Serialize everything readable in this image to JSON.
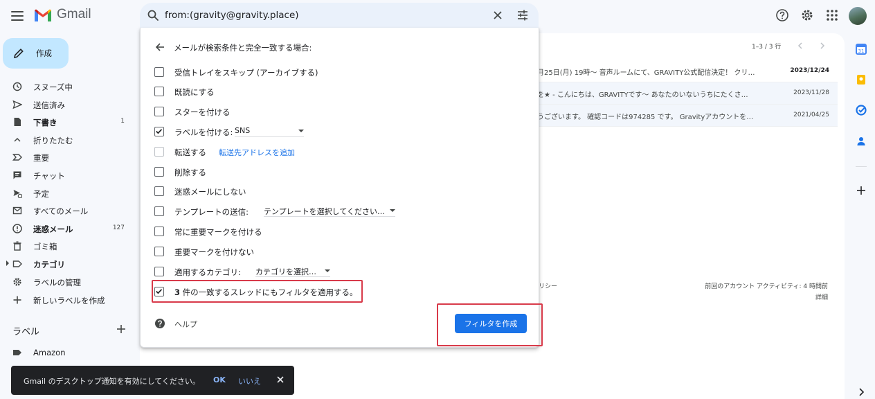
{
  "header": {
    "logo_text": "Gmail",
    "search_value": "from:(gravity@gravity.place)",
    "icons": [
      "menu-icon",
      "gmail-logo",
      "search-icon",
      "clear-icon",
      "tune-icon",
      "help-icon",
      "gear-icon",
      "apps-icon",
      "avatar"
    ]
  },
  "sidebar": {
    "compose_label": "作成",
    "items": [
      {
        "label": "スヌーズ中",
        "count": "",
        "icon": "clock-icon",
        "bold": false
      },
      {
        "label": "送信済み",
        "count": "",
        "icon": "send-icon",
        "bold": false
      },
      {
        "label": "下書き",
        "count": "1",
        "icon": "draft-icon",
        "bold": true
      },
      {
        "label": "折りたたむ",
        "count": "",
        "icon": "chevron-up-icon",
        "bold": false
      },
      {
        "label": "重要",
        "count": "",
        "icon": "important-icon",
        "bold": false
      },
      {
        "label": "チャット",
        "count": "",
        "icon": "chat-icon",
        "bold": false
      },
      {
        "label": "予定",
        "count": "",
        "icon": "scheduled-icon",
        "bold": false
      },
      {
        "label": "すべてのメール",
        "count": "",
        "icon": "all-mail-icon",
        "bold": false
      },
      {
        "label": "迷惑メール",
        "count": "127",
        "icon": "spam-icon",
        "bold": true
      },
      {
        "label": "ゴミ箱",
        "count": "",
        "icon": "trash-icon",
        "bold": false
      },
      {
        "label": "カテゴリ",
        "count": "",
        "icon": "label-outline-icon",
        "bold": true
      },
      {
        "label": "ラベルの管理",
        "count": "",
        "icon": "gear-icon",
        "bold": false
      },
      {
        "label": "新しいラベルを作成",
        "count": "",
        "icon": "plus-icon",
        "bold": false
      }
    ],
    "labels_heading": "ラベル",
    "label_items": [
      {
        "label": "Amazon"
      }
    ]
  },
  "mail_list": {
    "pager": "1–3 / 3 行",
    "rows": [
      {
        "snippet": "月25日(月) 19時〜 音声ルームにて、GRAVITY公式配信決定！ クリ…",
        "date": "2023/12/24",
        "unread": true
      },
      {
        "snippet": "を★ - こんにちは、GRAVITYです〜 あなたのいないうちにたくさ…",
        "date": "2023/11/28",
        "unread": false
      },
      {
        "snippet": "うございます。 確認コードは974285 です。 Gravityアカウントを…",
        "date": "2021/04/25",
        "unread": false
      }
    ],
    "footer_left": "リシー",
    "footer_right_line1": "前回のアカウント アクティビティ: 4 時間前",
    "footer_right_line2": "詳細"
  },
  "filter": {
    "heading": "メールが検索条件と完全一致する場合:",
    "options": [
      {
        "label": "受信トレイをスキップ (アーカイブする)",
        "checked": false
      },
      {
        "label": "既読にする",
        "checked": false
      },
      {
        "label": "スターを付ける",
        "checked": false
      },
      {
        "label": "ラベルを付ける:",
        "checked": true,
        "select": "SNS"
      },
      {
        "label": "転送する",
        "checked": false,
        "link": "転送先アドレスを追加"
      },
      {
        "label": "削除する",
        "checked": false
      },
      {
        "label": "迷惑メールにしない",
        "checked": false
      },
      {
        "label": "テンプレートの送信:",
        "checked": false,
        "select": "テンプレートを選択してください…"
      },
      {
        "label": "常に重要マークを付ける",
        "checked": false
      },
      {
        "label": "重要マークを付けない",
        "checked": false
      },
      {
        "label": "適用するカテゴリ:",
        "checked": false,
        "select": "カテゴリを選択…"
      },
      {
        "label_bold": "3",
        "label": " 件の一致するスレッドにもフィルタを適用する。",
        "checked": true
      }
    ],
    "help_label": "ヘルプ",
    "create_button": "フィルタを作成",
    "highlight_color": "#d83a4a"
  },
  "snackbar": {
    "message": "Gmail のデスクトップ通知を有効にしてください。",
    "ok": "OK",
    "no": "いいえ"
  },
  "colors": {
    "background": "#f6f8fc",
    "compose": "#c2e7ff",
    "search": "#eaf1fb",
    "primary": "#1a73e8",
    "snackbar": "#202124"
  }
}
